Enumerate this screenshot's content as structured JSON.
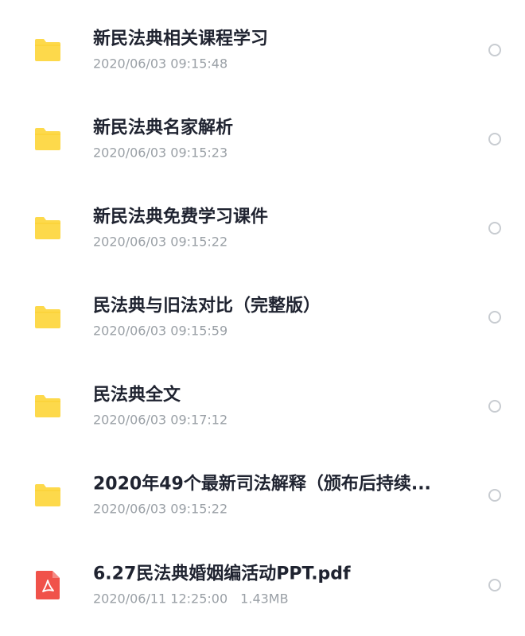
{
  "files": [
    {
      "name": "新民法典相关课程学习",
      "date": "2020/06/03 09:15:48",
      "size": "",
      "icon": "folder-icon"
    },
    {
      "name": "新民法典名家解析",
      "date": "2020/06/03 09:15:23",
      "size": "",
      "icon": "folder-icon"
    },
    {
      "name": "新民法典免费学习课件",
      "date": "2020/06/03 09:15:22",
      "size": "",
      "icon": "folder-icon"
    },
    {
      "name": "民法典与旧法对比（完整版）",
      "date": "2020/06/03 09:15:59",
      "size": "",
      "icon": "folder-icon"
    },
    {
      "name": "民法典全文",
      "date": "2020/06/03 09:17:12",
      "size": "",
      "icon": "folder-icon"
    },
    {
      "name": "2020年49个最新司法解释（颁布后持续...",
      "date": "2020/06/03 09:15:22",
      "size": "",
      "icon": "folder-icon"
    },
    {
      "name": "6.27民法典婚姻编活动PPT.pdf",
      "date": "2020/06/11 12:25:00",
      "size": "1.43MB",
      "icon": "pdf-icon"
    }
  ],
  "colors": {
    "folder": "#fdd94b",
    "pdf": "#f0524a",
    "title": "#1f2330",
    "meta": "#9aa0a6"
  }
}
